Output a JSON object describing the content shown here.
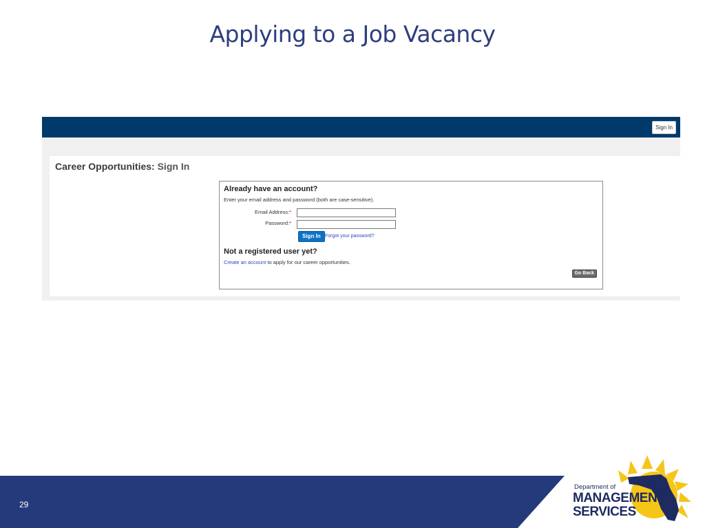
{
  "slide": {
    "title": "Applying to a Job Vacancy",
    "page_number": "29"
  },
  "portal": {
    "topbar": {
      "signin_label": "Sign In"
    },
    "heading": {
      "main": "Career Opportunities:",
      "sub": "Sign In"
    },
    "login": {
      "account_heading": "Already have an account?",
      "instructions": "Enter your email address and password (both are case-sensitive).",
      "email_label": "Email Address:",
      "password_label": "Password:",
      "required_mark": "*",
      "email_value": "",
      "password_value": "",
      "signin_button": "Sign In",
      "forgot_link": "Forgot your password?",
      "notreg_heading": "Not a registered user yet?",
      "create_link": "Create an account",
      "create_suffix": " to apply for our career opportunities.",
      "goback_button": "Go Back"
    }
  },
  "logo": {
    "line1": "Department of",
    "line2": "MANAGEMENT",
    "line3": "SERVICES"
  },
  "colors": {
    "title": "#2e3e7e",
    "topbar": "#003a6b",
    "footer_band": "#253a7a",
    "signin_button": "#0e72c4",
    "logo_sun": "#f5c518"
  }
}
